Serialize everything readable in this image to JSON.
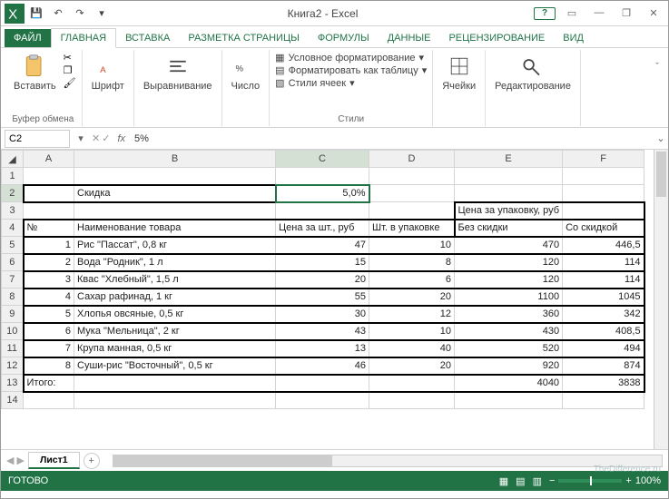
{
  "title": "Книга2 - Excel",
  "qat": {
    "save": "💾",
    "undo": "↶",
    "redo": "↷"
  },
  "winctrl": {
    "help": "?",
    "opts": "▭",
    "min": "—",
    "max": "❐",
    "close": "✕"
  },
  "tabs": {
    "file": "ФАЙЛ",
    "home": "ГЛАВНАЯ",
    "insert": "ВСТАВКА",
    "pagelayout": "РАЗМЕТКА СТРАНИЦЫ",
    "formulas": "ФОРМУЛЫ",
    "data": "ДАННЫЕ",
    "review": "РЕЦЕНЗИРОВАНИЕ",
    "view": "ВИД"
  },
  "ribbon": {
    "clipboard": {
      "paste": "Вставить",
      "label": "Буфер обмена"
    },
    "font": {
      "big": "Шрифт",
      "label": ""
    },
    "align": {
      "big": "Выравнивание",
      "label": ""
    },
    "number": {
      "big": "Число",
      "label": ""
    },
    "styles": {
      "cond": "Условное форматирование",
      "astable": "Форматировать как таблицу",
      "cellstyles": "Стили ячеек",
      "label": "Стили"
    },
    "cells": {
      "big": "Ячейки",
      "label": ""
    },
    "editing": {
      "big": "Редактирование",
      "label": ""
    }
  },
  "namebox": "C2",
  "formula": "5%",
  "fxsym": {
    "cancel": "✕",
    "ok": "✓",
    "fx": "fx"
  },
  "cols": [
    "A",
    "B",
    "C",
    "D",
    "E",
    "F"
  ],
  "sheet": {
    "r2": {
      "b": "Скидка",
      "c": "5,0%"
    },
    "r3": {
      "e": "Цена за упаковку, руб"
    },
    "r4": {
      "a": "№",
      "b": "Наименование товара",
      "c": "Цена за шт., руб",
      "d": "Шт. в упаковке",
      "e": "Без скидки",
      "f": "Со скидкой"
    },
    "r5": {
      "a": "1",
      "b": "Рис \"Пассат\", 0,8 кг",
      "c": "47",
      "d": "10",
      "e": "470",
      "f": "446,5"
    },
    "r6": {
      "a": "2",
      "b": "Вода \"Родник\", 1 л",
      "c": "15",
      "d": "8",
      "e": "120",
      "f": "114"
    },
    "r7": {
      "a": "3",
      "b": "Квас \"Хлебный\", 1,5 л",
      "c": "20",
      "d": "6",
      "e": "120",
      "f": "114"
    },
    "r8": {
      "a": "4",
      "b": "Сахар рафинад, 1 кг",
      "c": "55",
      "d": "20",
      "e": "1100",
      "f": "1045"
    },
    "r9": {
      "a": "5",
      "b": "Хлопья овсяные, 0,5 кг",
      "c": "30",
      "d": "12",
      "e": "360",
      "f": "342"
    },
    "r10": {
      "a": "6",
      "b": "Мука \"Мельница\", 2 кг",
      "c": "43",
      "d": "10",
      "e": "430",
      "f": "408,5"
    },
    "r11": {
      "a": "7",
      "b": "Крупа манная, 0,5 кг",
      "c": "13",
      "d": "40",
      "e": "520",
      "f": "494"
    },
    "r12": {
      "a": "8",
      "b": "Суши-рис \"Восточный\", 0,5 кг",
      "c": "46",
      "d": "20",
      "e": "920",
      "f": "874"
    },
    "r13": {
      "a": "Итого:",
      "e": "4040",
      "f": "3838"
    }
  },
  "sheets": {
    "nav": "◀ ▶",
    "tab1": "Лист1",
    "add": "+"
  },
  "status": {
    "ready": "ГОТОВО",
    "zoom": "100%",
    "minus": "−",
    "plus": "+"
  },
  "watermark": "TheDifference.ru"
}
